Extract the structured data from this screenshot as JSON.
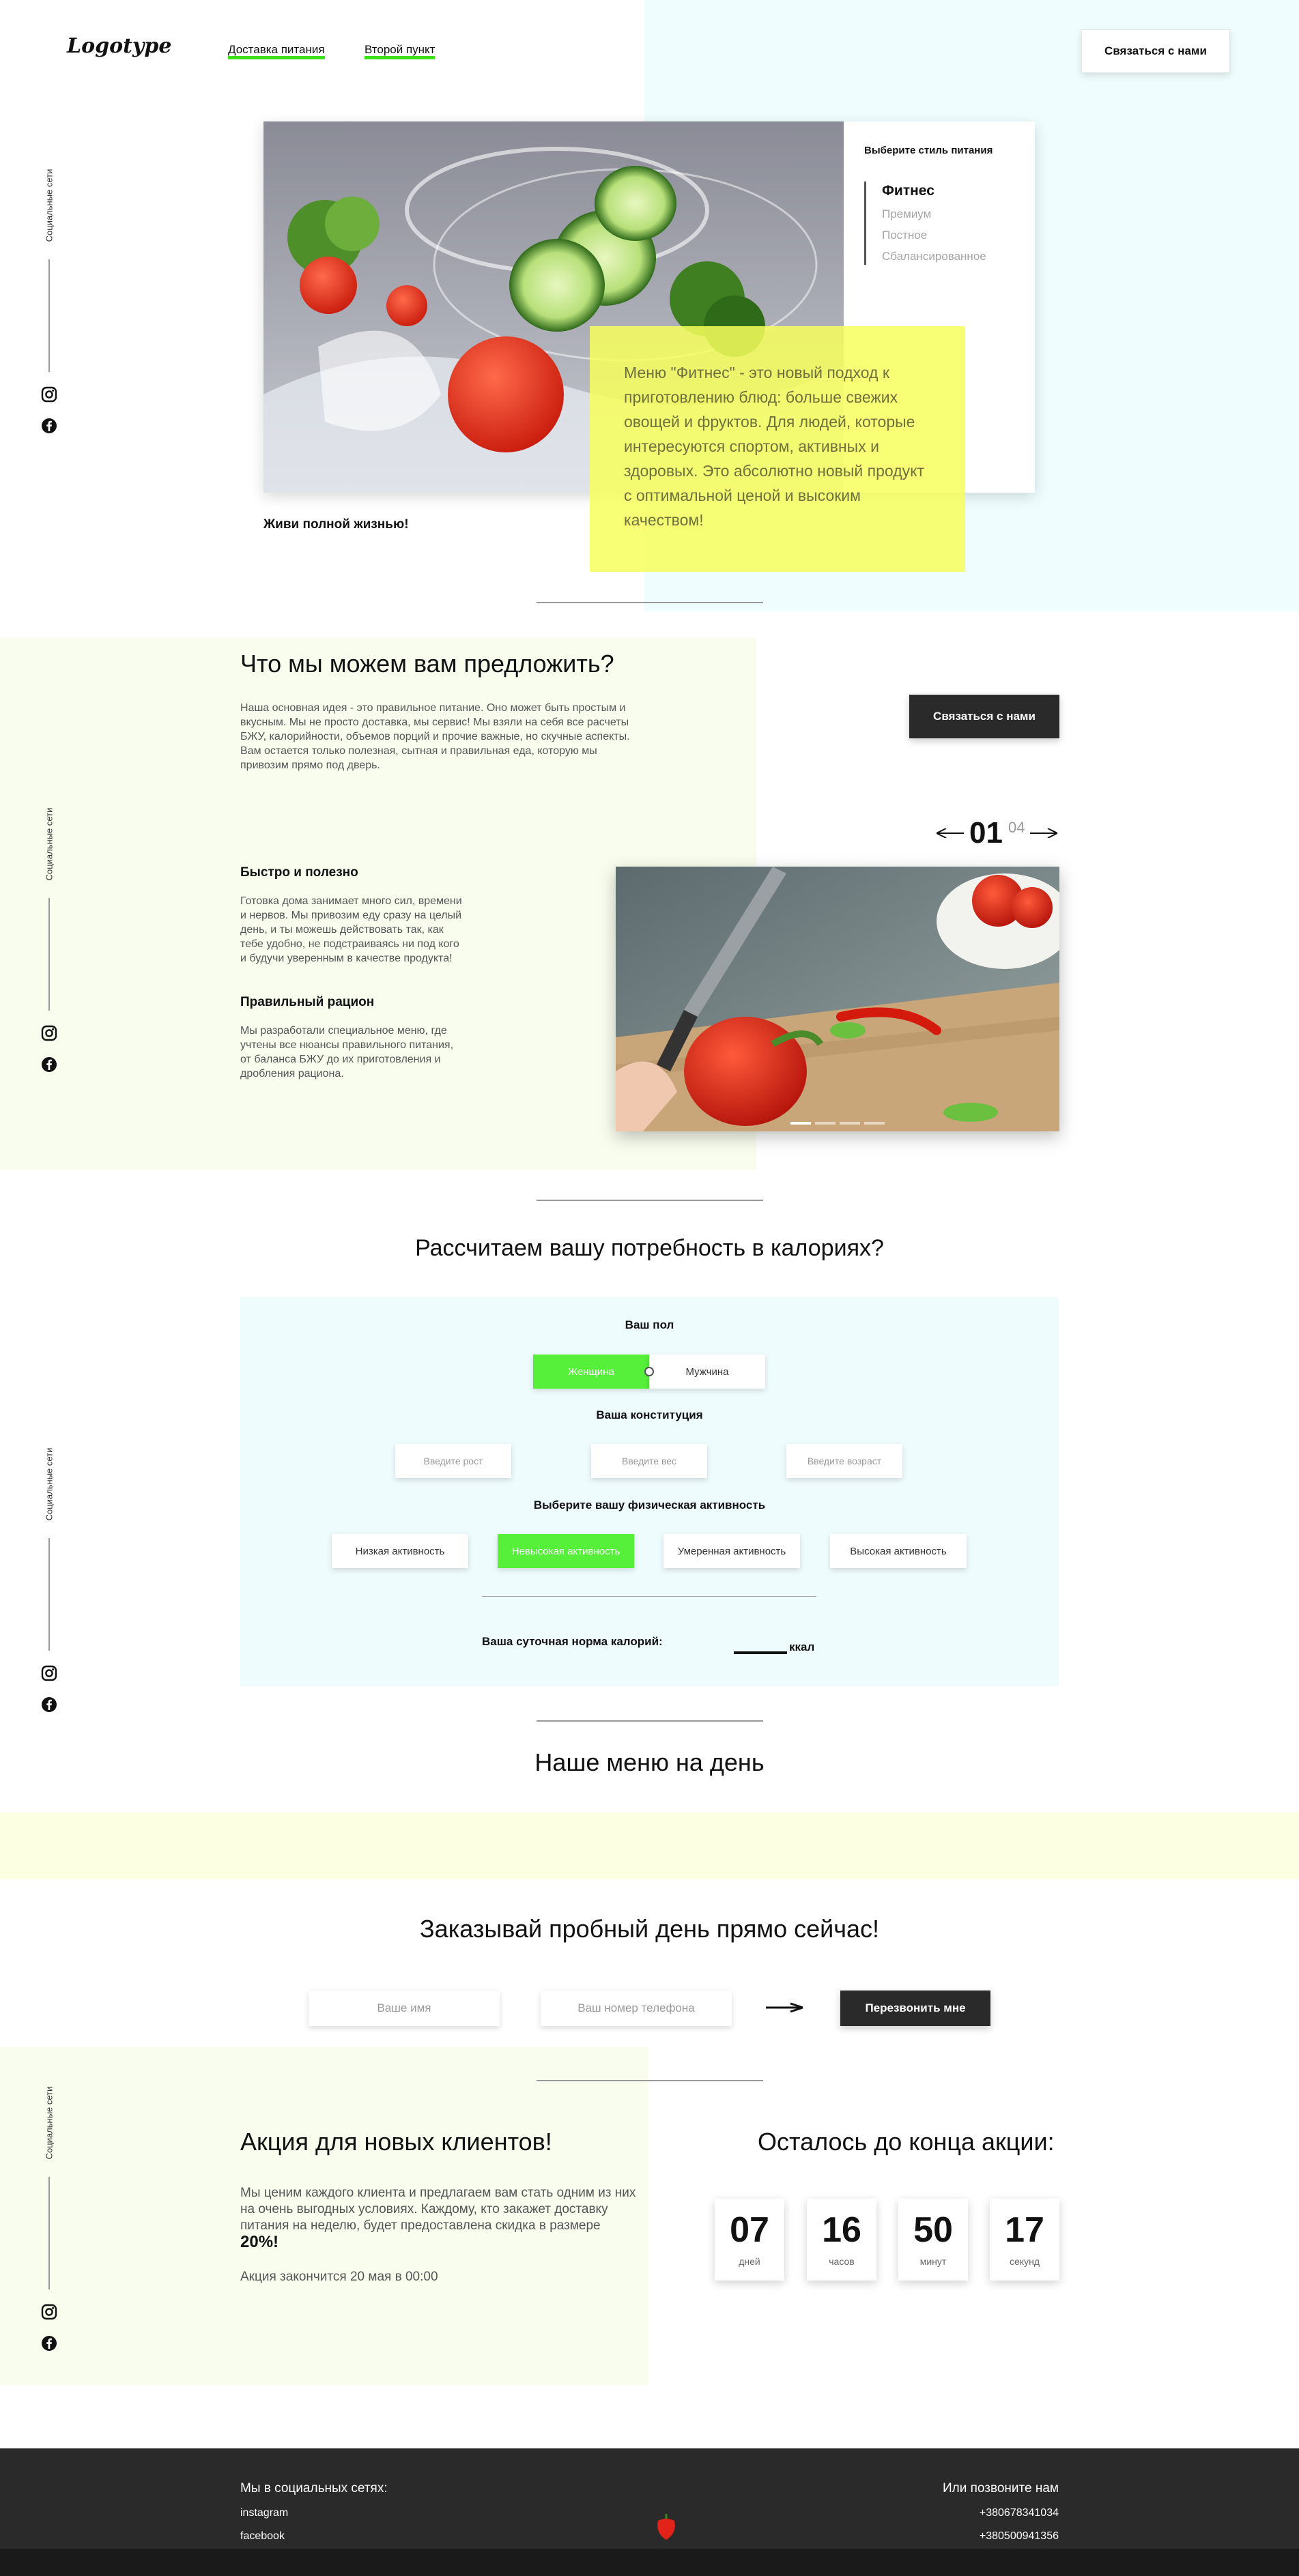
{
  "header": {
    "logo": "Logotype",
    "nav": [
      "Доставка питания",
      "Второй пункт"
    ],
    "contact_button": "Связаться с нами"
  },
  "social": {
    "label": "Социальные сети",
    "icons": [
      "instagram-icon",
      "facebook-icon"
    ]
  },
  "hero": {
    "diet_title": "Выберите стиль питания",
    "diets": [
      "Фитнес",
      "Премиум",
      "Постное",
      "Сбалансированное"
    ],
    "description": "Меню \"Фитнес\" - это новый подход к приготовлению блюд: больше свежих овощей и фруктов. Для людей, которые интересуются спортом, активных и здоровых. Это абсолютно новый продукт с оптимальной ценой и высоким качеством!",
    "tagline": "Живи полной жизнью!"
  },
  "offer": {
    "title": "Что мы можем вам предложить?",
    "text": "Наша основная идея - это правильное питание. Оно может быть простым и вкусным. Мы не просто доставка, мы сервис! Мы взяли на себя все расчеты БЖУ, калорийности, объемов порций и прочие важные, но скучные аспекты. Вам остается только полезная, сытная и правильная еда, которую мы привозим прямо под дверь.",
    "contact_button": "Связаться с нами",
    "feature1_title": "Быстро и полезно",
    "feature1_text": "Готовка дома занимает много сил, времени и нервов. Мы привозим еду сразу на целый день, и ты можешь действовать так, как тебе удобно, не подстраиваясь ни под кого и будучи уверенным в качестве продукта!",
    "feature2_title": "Правильный рацион",
    "feature2_text": "Мы разработали специальное меню, где учтены все нюансы правильного питания, от баланса БЖУ до их приготовления и дробления рациона.",
    "slide_current": "01",
    "slide_total": "04"
  },
  "calc": {
    "title": "Рассчитаем вашу потребность в калориях?",
    "gender_label": "Ваш пол",
    "gender_options": [
      "Женщина",
      "Мужчина"
    ],
    "constitution_label": "Ваша конституция",
    "height_placeholder": "Введите рост",
    "weight_placeholder": "Введите вес",
    "age_placeholder": "Введите возраст",
    "activity_label": "Выберите вашу физическая активность",
    "activity_options": [
      "Низкая активность",
      "Невысокая активность",
      "Умеренная активность",
      "Высокая активность"
    ],
    "result_label": "Ваша суточная норма калорий:",
    "result_value": "",
    "result_unit": "ккал"
  },
  "menu": {
    "title": "Наше меню на день"
  },
  "order": {
    "title": "Заказывай пробный день прямо сейчас!",
    "name_placeholder": "Ваше имя",
    "phone_placeholder": "Ваш номер телефона",
    "button": "Перезвонить мне"
  },
  "promo": {
    "title": "Акция для новых клиентов!",
    "text": "Мы ценим каждого клиента и предлагаем вам стать одним из них на очень выгодных условиях. Каждому, кто закажет доставку питания на неделю, будет предоставлена скидка в размере",
    "discount": "20%!",
    "ends": "Акция закончится 20 мая в 00:00",
    "countdown_title": "Осталось до конца акции:",
    "countdown": [
      {
        "value": "07",
        "unit": "дней"
      },
      {
        "value": "16",
        "unit": "часов"
      },
      {
        "value": "50",
        "unit": "минут"
      },
      {
        "value": "17",
        "unit": "секунд"
      }
    ]
  },
  "footer": {
    "social_title": "Мы в социальных сетях:",
    "links": [
      "instagram",
      "facebook"
    ],
    "call_title": "Или позвоните нам",
    "phones": [
      "+380678341034",
      "+380500941356"
    ]
  },
  "colors": {
    "accent_green": "#56f03a",
    "highlight_yellow": "#f7ff5c",
    "dark": "#2a2a2a"
  }
}
